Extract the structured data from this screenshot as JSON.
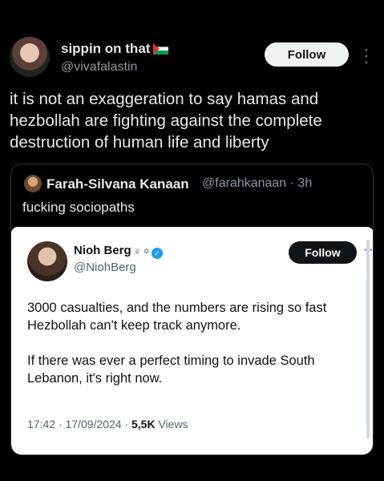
{
  "post": {
    "author_name": "sippin on that",
    "author_flag": "palestine-flag-emoji",
    "author_handle": "@vivafalastin",
    "follow_label": "Follow",
    "text": "it is not an exaggeration to say hamas and\nhezbollah are fighting against the complete\ndestruction of human life and liberty"
  },
  "quote": {
    "author_name": "Farah-Silvana Kanaan",
    "meta": "@farahkanaan · 3h",
    "text": "fucking sociopaths"
  },
  "embedded": {
    "author_name": "Nioh Berg",
    "badges": "♕ ✡",
    "author_handle": "@NiohBerg",
    "follow_label": "Follow",
    "text": "3000 casualties, and the numbers are rising so fast\nHezbollah can't keep track anymore.\n\nIf there was ever a perfect timing to invade South\nLebanon, it's right now.",
    "timestamp": "17:42 · 17/09/2024 · ",
    "views_count": "5,5K",
    "views_label": " Views"
  },
  "colors": {
    "background": "#000000",
    "verified": "#1d9bf0",
    "muted": "#8b98a5"
  }
}
